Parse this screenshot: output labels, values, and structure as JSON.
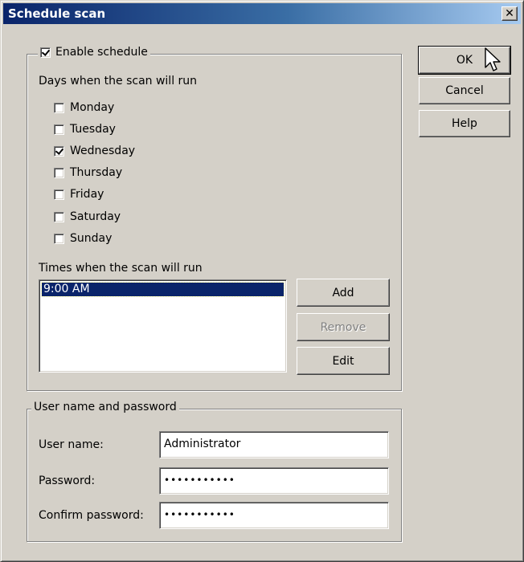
{
  "window": {
    "title": "Schedule scan"
  },
  "buttons": {
    "ok": "OK",
    "cancel": "Cancel",
    "help": "Help"
  },
  "schedule": {
    "enable_label": "Enable schedule",
    "enable_checked": true,
    "days_heading": "Days when the scan will run",
    "days": [
      {
        "label": "Monday",
        "checked": false
      },
      {
        "label": "Tuesday",
        "checked": false
      },
      {
        "label": "Wednesday",
        "checked": true
      },
      {
        "label": "Thursday",
        "checked": false
      },
      {
        "label": "Friday",
        "checked": false
      },
      {
        "label": "Saturday",
        "checked": false
      },
      {
        "label": "Sunday",
        "checked": false
      }
    ],
    "times_heading": "Times when the scan will run",
    "times": [
      "9:00 AM"
    ],
    "add_label": "Add",
    "remove_label": "Remove",
    "edit_label": "Edit"
  },
  "credentials": {
    "group_label": "User name and password",
    "user_label": "User name:",
    "user_value": "Administrator",
    "password_label": "Password:",
    "password_value": "•••••••••••",
    "confirm_label": "Confirm password:",
    "confirm_value": "•••••••••••"
  }
}
